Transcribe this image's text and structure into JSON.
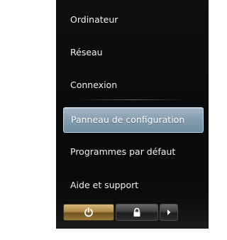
{
  "start_menu": {
    "items": [
      {
        "label": "Ordinateur",
        "selected": false
      },
      {
        "label": "Réseau",
        "selected": false
      },
      {
        "label": "Connexion",
        "selected": false
      },
      {
        "label": "Panneau de configuration",
        "selected": true
      },
      {
        "label": "Programmes par défaut",
        "selected": false
      },
      {
        "label": "Aide et support",
        "selected": false
      }
    ],
    "buttons": {
      "shutdown_icon": "power-icon",
      "lock_icon": "lock-icon",
      "more_icon": "triangle-right-icon"
    }
  },
  "colors": {
    "menu_background": "#0b0c0d",
    "selection": "#86a0b2",
    "text": "#f2f2f2",
    "shutdown_button": "#b08a45"
  }
}
